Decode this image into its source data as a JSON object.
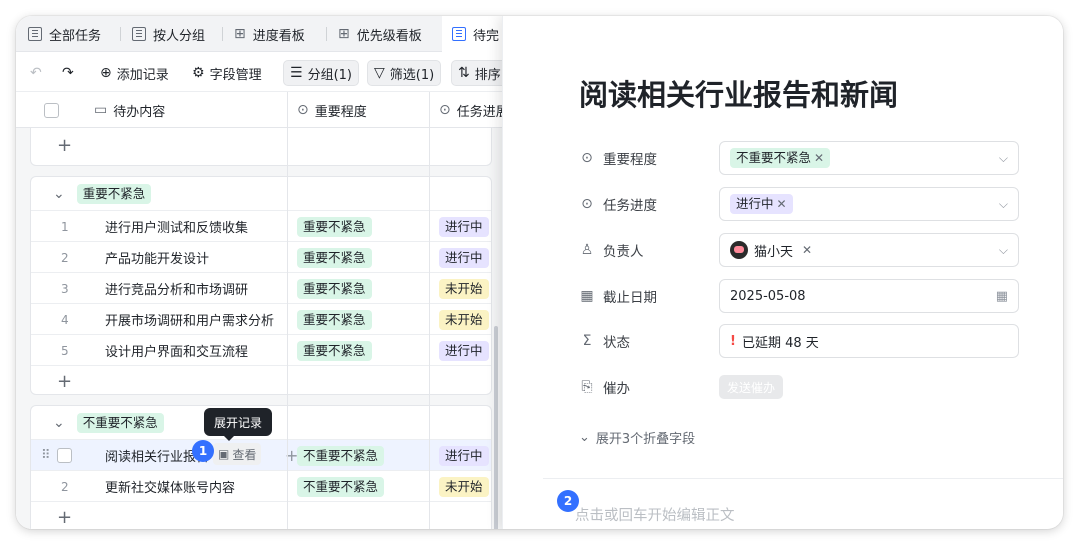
{
  "tabs": [
    {
      "label": "全部任务"
    },
    {
      "label": "按人分组"
    },
    {
      "label": "进度看板"
    },
    {
      "label": "优先级看板"
    },
    {
      "label": "待完"
    }
  ],
  "toolbar": {
    "undo_icon": "undo-icon",
    "redo_icon": "redo-icon",
    "add_record": "添加记录",
    "field_manage": "字段管理",
    "group": "分组(1)",
    "filter": "筛选(1)",
    "sort": "排序"
  },
  "columns": {
    "todo": "待办内容",
    "importance": "重要程度",
    "progress": "任务进展"
  },
  "groups": [
    {
      "name": "重要不紧急",
      "rows": [
        {
          "num": "1",
          "title": "进行用户测试和反馈收集",
          "importance": "重要不紧急",
          "progress": "进行中"
        },
        {
          "num": "2",
          "title": "产品功能开发设计",
          "importance": "重要不紧急",
          "progress": "进行中"
        },
        {
          "num": "3",
          "title": "进行竞品分析和市场调研",
          "importance": "重要不紧急",
          "progress": "未开始"
        },
        {
          "num": "4",
          "title": "开展市场调研和用户需求分析",
          "importance": "重要不紧急",
          "progress": "未开始"
        },
        {
          "num": "5",
          "title": "设计用户界面和交互流程",
          "importance": "重要不紧急",
          "progress": "进行中"
        }
      ]
    },
    {
      "name": "不重要不紧急",
      "rows": [
        {
          "num": "",
          "title": "阅读相关行业报告",
          "importance": "不重要不紧急",
          "progress": "进行中"
        },
        {
          "num": "2",
          "title": "更新社交媒体账号内容",
          "importance": "不重要不紧急",
          "progress": "未开始"
        }
      ]
    }
  ],
  "tooltip": "展开记录",
  "view_button": "查看",
  "badges": [
    "1",
    "2"
  ],
  "detail": {
    "title": "阅读相关行业报告和新闻",
    "fields": {
      "importance": {
        "label": "重要程度",
        "value": "不重要不紧急"
      },
      "progress": {
        "label": "任务进度",
        "value": "进行中"
      },
      "owner": {
        "label": "负责人",
        "value": "猫小天"
      },
      "deadline": {
        "label": "截止日期",
        "value": "2025-05-08"
      },
      "status": {
        "label": "状态",
        "value": "已延期 48 天"
      },
      "remind": {
        "label": "催办",
        "value": "发送催办"
      }
    },
    "expand": "展开3个折叠字段",
    "editor_hint": "点击或回车开始编辑正文"
  },
  "colors": {
    "accent": "#3370ff",
    "tag_green": "#d9f5e7",
    "tag_purple": "#e6e3ff",
    "tag_yellow": "#fbf3c4",
    "overdue": "#f54a45"
  }
}
